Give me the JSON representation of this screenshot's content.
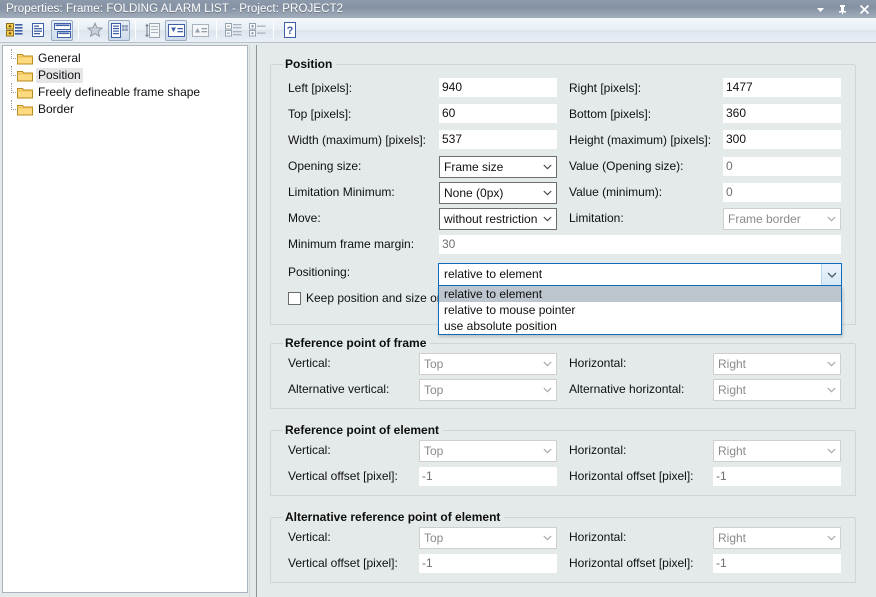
{
  "window": {
    "title": "Properties: Frame: FOLDING ALARM LIST - Project: PROJECT2",
    "buttons": [
      {
        "name": "minimize-chevron",
        "glyph": "chevron-down-icon"
      },
      {
        "name": "pin",
        "glyph": "pin-icon"
      },
      {
        "name": "close",
        "glyph": "close-icon"
      }
    ]
  },
  "toolbar": {
    "items": [
      {
        "name": "new-entry-icon",
        "state": "enabled"
      },
      {
        "name": "document-properties-icon",
        "state": "enabled"
      },
      {
        "name": "frame-layout-icon",
        "state": "active"
      },
      {
        "name": "favorite-star-icon",
        "state": "disabled"
      },
      {
        "name": "list-properties-icon",
        "state": "enabled"
      },
      {
        "name": "vertical-size-icon",
        "state": "disabled"
      },
      {
        "name": "move-down-icon",
        "state": "enabled"
      },
      {
        "name": "move-up-icon",
        "state": "disabled"
      },
      {
        "name": "collapse-all-icon",
        "state": "disabled"
      },
      {
        "name": "expand-all-icon",
        "state": "disabled"
      },
      {
        "name": "help-icon",
        "state": "enabled"
      }
    ]
  },
  "tree": {
    "items": [
      {
        "label": "General",
        "selected": false
      },
      {
        "label": "Position",
        "selected": true
      },
      {
        "label": "Freely defineable frame shape",
        "selected": false
      },
      {
        "label": "Border",
        "selected": false
      }
    ]
  },
  "position_group": {
    "title": "Position",
    "fields": {
      "left_label": "Left [pixels]:",
      "left_value": "940",
      "right_label": "Right [pixels]:",
      "right_value": "1477",
      "top_label": "Top [pixels]:",
      "top_value": "60",
      "bottom_label": "Bottom [pixels]:",
      "bottom_value": "360",
      "width_label": "Width (maximum)  [pixels]:",
      "width_value": "537",
      "height_label": "Height (maximum) [pixels]:",
      "height_value": "300",
      "opening_size_label": "Opening size:",
      "opening_size_value": "Frame size",
      "value_opening_label": "Value (Opening size):",
      "value_opening_value": "0",
      "limitation_min_label": "Limitation Minimum:",
      "limitation_min_value": "None (0px)",
      "value_min_label": "Value (minimum):",
      "value_min_value": "0",
      "move_label": "Move:",
      "move_value": "without restriction",
      "limitation_label": "Limitation:",
      "limitation_value": "Frame border",
      "min_frame_margin_label": "Minimum frame margin:",
      "min_frame_margin_value": "30",
      "positioning_label": "Positioning:",
      "positioning_value": "relative to element",
      "keep_position_label": "Keep position and size on",
      "keep_position_checked": false
    },
    "positioning_options": [
      {
        "label": "relative to element",
        "selected": true
      },
      {
        "label": "relative to mouse pointer",
        "selected": false
      },
      {
        "label": "use absolute position",
        "selected": false
      }
    ]
  },
  "reference_point_frame": {
    "title": "Reference point of frame",
    "vertical_label": "Vertical:",
    "vertical_value": "Top",
    "horizontal_label": "Horizontal:",
    "horizontal_value": "Right",
    "alt_vertical_label": "Alternative vertical:",
    "alt_vertical_value": "Top",
    "alt_horizontal_label": "Alternative horizontal:",
    "alt_horizontal_value": "Right"
  },
  "reference_point_element": {
    "title": "Reference point of element",
    "vertical_label": "Vertical:",
    "vertical_value": "Top",
    "horizontal_label": "Horizontal:",
    "horizontal_value": "Right",
    "vertical_offset_label": "Vertical offset  [pixel]:",
    "vertical_offset_value": "-1",
    "horizontal_offset_label": "Horizontal offset [pixel]:",
    "horizontal_offset_value": "-1"
  },
  "alt_reference_point_element": {
    "title": "Alternative reference point of element",
    "vertical_label": "Vertical:",
    "vertical_value": "Top",
    "horizontal_label": "Horizontal:",
    "horizontal_value": "Right",
    "vertical_offset_label": "Vertical offset  [pixel]:",
    "vertical_offset_value": "-1",
    "horizontal_offset_label": "Horizontal offset [pixel]:",
    "horizontal_offset_value": "-1"
  },
  "colors": {
    "titlebar": "#8a97a8",
    "panel_bg": "#e4eaea",
    "accent_focus": "#0f6cbd",
    "dropdown_selected": "#bdc6ce"
  }
}
